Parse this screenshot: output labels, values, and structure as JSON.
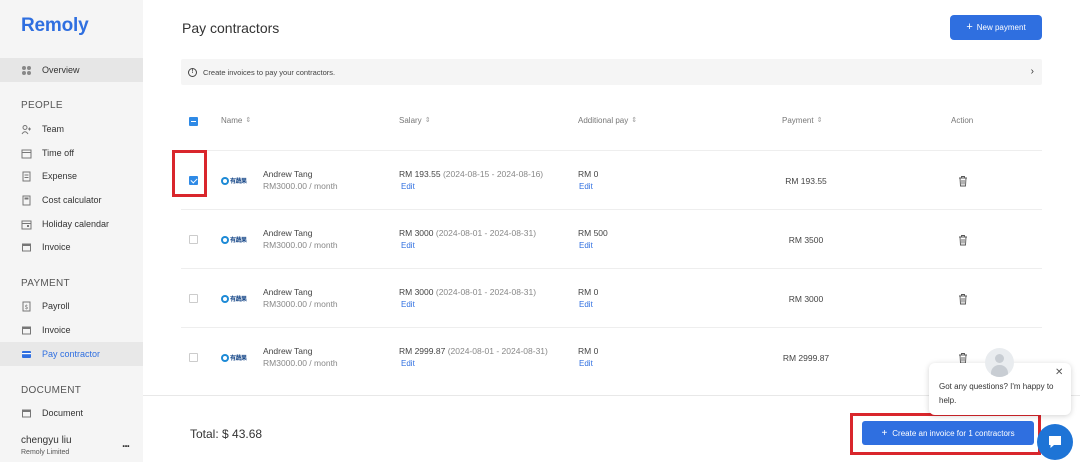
{
  "app": {
    "logo": "Remoly"
  },
  "sidebar": {
    "overview": "Overview",
    "people_label": "PEOPLE",
    "people_items": [
      "Team",
      "Time off",
      "Expense",
      "Cost calculator",
      "Holiday calendar",
      "Invoice"
    ],
    "payment_label": "PAYMENT",
    "payment_items": [
      "Payroll",
      "Invoice",
      "Pay contractor"
    ],
    "document_label": "DOCUMENT",
    "document_items": [
      "Document"
    ],
    "user": {
      "name": "chengyu liu",
      "company": "Remoly Limited",
      "more": "..."
    }
  },
  "header": {
    "title": "Pay contractors",
    "new_payment": "New payment"
  },
  "info_bar": {
    "text": "Create invoices to pay your contractors.",
    "chevron": "›"
  },
  "table": {
    "columns": {
      "name": "Name",
      "salary": "Salary",
      "additional": "Additional pay",
      "payment": "Payment",
      "action": "Action"
    },
    "edit_label": "Edit",
    "rows": [
      {
        "checked": true,
        "avatar_text": "有蔬果",
        "name": "Andrew   Tang",
        "rate": "RM3000.00 / month",
        "salary_amount": "RM 193.55",
        "salary_range": "(2024-08-15 - 2024-08-16)",
        "additional": "RM 0",
        "payment": "RM 193.55"
      },
      {
        "checked": false,
        "avatar_text": "有蔬果",
        "name": "Andrew   Tang",
        "rate": "RM3000.00 / month",
        "salary_amount": "RM 3000",
        "salary_range": "(2024-08-01 - 2024-08-31)",
        "additional": "RM 500",
        "payment": "RM 3500"
      },
      {
        "checked": false,
        "avatar_text": "有蔬果",
        "name": "Andrew   Tang",
        "rate": "RM3000.00 / month",
        "salary_amount": "RM 3000",
        "salary_range": "(2024-08-01 - 2024-08-31)",
        "additional": "RM 0",
        "payment": "RM 3000"
      },
      {
        "checked": false,
        "avatar_text": "有蔬果",
        "name": "Andrew   Tang",
        "rate": "RM3000.00 / month",
        "salary_amount": "RM 2999.87",
        "salary_range": "(2024-08-01 - 2024-08-31)",
        "additional": "RM 0",
        "payment": "RM 2999.87"
      }
    ]
  },
  "footer": {
    "total": "Total: $ 43.68",
    "create_button": "Create an invoice for 1 contractors"
  },
  "chat": {
    "message": "Got any questions? I'm happy to help.",
    "close": "✕"
  },
  "colors": {
    "accent": "#2f6fe0",
    "highlight": "#d9262c"
  }
}
